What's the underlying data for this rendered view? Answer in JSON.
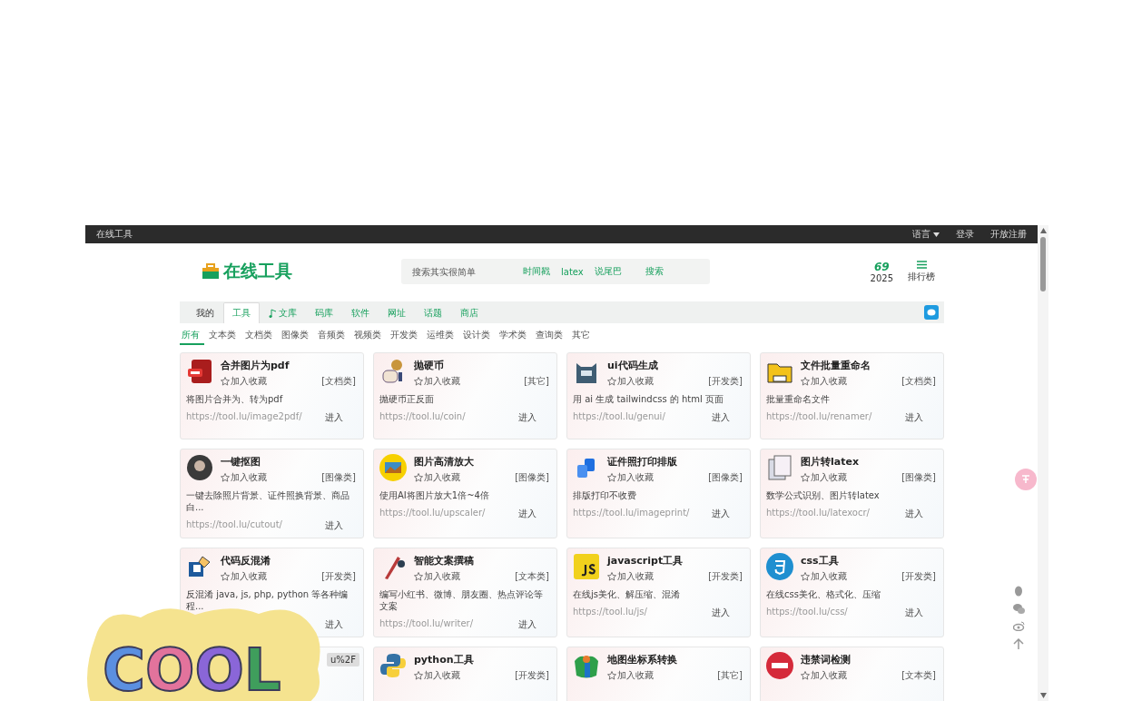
{
  "top_bar": {
    "site": "在线工具",
    "language": "语言",
    "login": "登录",
    "register": "开放注册"
  },
  "header": {
    "logo": "在线工具",
    "search": {
      "placeholder": "搜索其实很简单"
    },
    "quick_links": [
      "时间戳",
      "latex",
      "说尾巴"
    ],
    "search_button": "搜索",
    "counter": {
      "value": "69",
      "year": "2025"
    },
    "ranking": "排行榜"
  },
  "nav_tabs": [
    {
      "label": "我的",
      "selected": false
    },
    {
      "label": "工具",
      "selected": true
    },
    {
      "label": "文库",
      "selected": false
    },
    {
      "label": "码库",
      "selected": false
    },
    {
      "label": "软件",
      "selected": false
    },
    {
      "label": "网址",
      "selected": false
    },
    {
      "label": "话题",
      "selected": false
    },
    {
      "label": "商店",
      "selected": false
    }
  ],
  "categories": [
    {
      "label": "所有",
      "selected": true
    },
    {
      "label": "文本类",
      "selected": false
    },
    {
      "label": "文档类",
      "selected": false
    },
    {
      "label": "图像类",
      "selected": false
    },
    {
      "label": "音频类",
      "selected": false
    },
    {
      "label": "视频类",
      "selected": false
    },
    {
      "label": "开发类",
      "selected": false
    },
    {
      "label": "运维类",
      "selected": false
    },
    {
      "label": "设计类",
      "selected": false
    },
    {
      "label": "学术类",
      "selected": false
    },
    {
      "label": "查询类",
      "selected": false
    },
    {
      "label": "其它",
      "selected": false
    }
  ],
  "cards": [
    {
      "title": "合并图片为pdf",
      "favorite": "加入收藏",
      "tag": "[文档类]",
      "description": "将图片合并为、转为pdf",
      "url": "https://tool.lu/image2pdf/",
      "enter": "进入"
    },
    {
      "title": "抛硬币",
      "favorite": "加入收藏",
      "tag": "[其它]",
      "description": "抛硬币正反面",
      "url": "https://tool.lu/coin/",
      "enter": "进入"
    },
    {
      "title": "ui代码生成",
      "favorite": "加入收藏",
      "tag": "[开发类]",
      "description": "用 ai 生成 tailwindcss 的 html 页面",
      "url": "https://tool.lu/genui/",
      "enter": "进入"
    },
    {
      "title": "文件批量重命名",
      "favorite": "加入收藏",
      "tag": "[文档类]",
      "description": "批量重命名文件",
      "url": "https://tool.lu/renamer/",
      "enter": "进入"
    },
    {
      "title": "一键抠图",
      "favorite": "加入收藏",
      "tag": "[图像类]",
      "description": "一键去除照片背景、证件照换背景、商品白...",
      "url": "https://tool.lu/cutout/",
      "enter": "进入"
    },
    {
      "title": "图片高清放大",
      "favorite": "加入收藏",
      "tag": "[图像类]",
      "description": "使用AI将图片放大1倍~4倍",
      "url": "https://tool.lu/upscaler/",
      "enter": "进入"
    },
    {
      "title": "证件照打印排版",
      "favorite": "加入收藏",
      "tag": "[图像类]",
      "description": "排版打印不收费",
      "url": "https://tool.lu/imageprint/",
      "enter": "进入"
    },
    {
      "title": "图片转latex",
      "favorite": "加入收藏",
      "tag": "[图像类]",
      "description": "数学公式识别、图片转latex",
      "url": "https://tool.lu/latexocr/",
      "enter": "进入"
    },
    {
      "title": "代码反混淆",
      "favorite": "加入收藏",
      "tag": "[开发类]",
      "description": "反混淆 java, js, php, python 等各种编程...",
      "enter": "进入"
    },
    {
      "title": "智能文案撰稿",
      "favorite": "加入收藏",
      "tag": "[文本类]",
      "description": "编写小红书、微博、朋友圈、热点评论等文案",
      "url": "https://tool.lu/writer/",
      "enter": "进入"
    },
    {
      "title": "javascript工具",
      "favorite": "加入收藏",
      "tag": "[开发类]",
      "description": "在线js美化、解压缩、混淆",
      "url": "https://tool.lu/js/",
      "enter": "进入"
    },
    {
      "title": "css工具",
      "favorite": "加入收藏",
      "tag": "[开发类]",
      "description": "在线css美化、格式化、压缩",
      "url": "https://tool.lu/css/",
      "enter": "进入"
    },
    {
      "tooltip": "u%2F"
    },
    {
      "title": "python工具",
      "favorite": "加入收藏",
      "tag": "[开发类]"
    },
    {
      "title": "地图坐标系转换",
      "favorite": "加入收藏",
      "tag": "[其它]"
    },
    {
      "title": "违禁词检测",
      "favorite": "加入收藏",
      "tag": "[文本类]"
    }
  ],
  "sticker": {
    "text": "COOL"
  }
}
